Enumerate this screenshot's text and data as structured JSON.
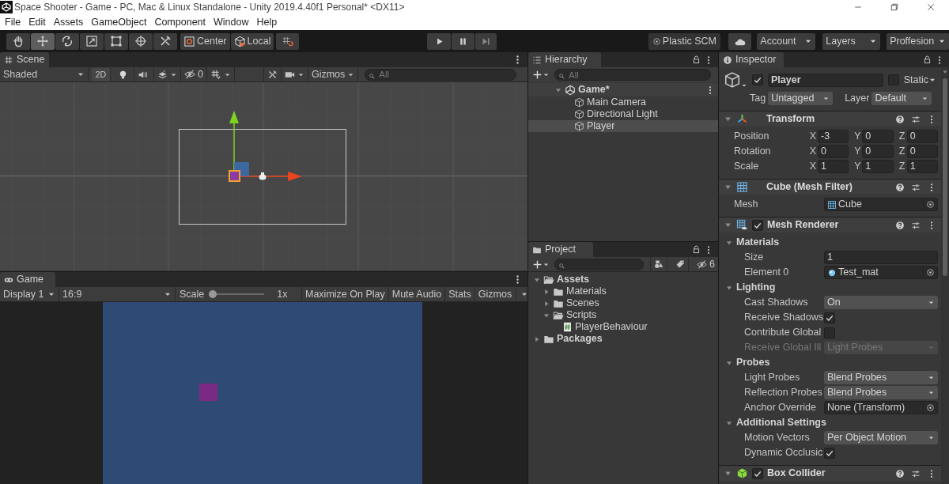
{
  "window": {
    "title": "Space Shooter - Game - PC, Mac & Linux Standalone - Unity 2019.4.40f1 Personal* <DX11>"
  },
  "menu": [
    "File",
    "Edit",
    "Assets",
    "GameObject",
    "Component",
    "Window",
    "Help"
  ],
  "toolbar": {
    "tools": [
      {
        "selected": false
      },
      {
        "selected": true
      },
      {
        "selected": false
      },
      {
        "selected": false
      },
      {
        "selected": false
      },
      {
        "selected": false
      },
      {
        "selected": false
      }
    ],
    "pivot": "Center",
    "space": "Local",
    "plastic": "Plastic SCM",
    "account": "Account",
    "layers": "Layers",
    "layout": "Proffesion"
  },
  "scene": {
    "tab": "Scene",
    "shading": "Shaded",
    "mode_2d": "2D",
    "hidden_count": "0",
    "gizmos": "Gizmos",
    "search_placeholder": "All"
  },
  "game": {
    "tab": "Game",
    "display": "Display 1",
    "aspect": "16:9",
    "scale_label": "Scale",
    "level": 0,
    "scale_value": "1x",
    "buttons": [
      "Maximize On Play",
      "Mute Audio",
      "Stats"
    ],
    "gizmos": "Gizmos"
  },
  "hierarchy": {
    "tab": "Hierarchy",
    "search_placeholder": "All",
    "scene": {
      "name": "Game*",
      "expanded": true,
      "children": [
        {
          "name": "Main Camera",
          "selected": false
        },
        {
          "name": "Directional Light",
          "selected": false
        },
        {
          "name": "Player",
          "selected": true
        }
      ]
    }
  },
  "project": {
    "tab": "Project",
    "hidden_count": "6",
    "tree": [
      {
        "name": "Assets",
        "kind": "folder",
        "expanded": true,
        "children": [
          {
            "name": "Materials",
            "kind": "folder",
            "expanded": false
          },
          {
            "name": "Scenes",
            "kind": "folder",
            "expanded": false
          },
          {
            "name": "Scripts",
            "kind": "folder",
            "expanded": true,
            "children": [
              {
                "name": "PlayerBehaviour",
                "kind": "script"
              }
            ]
          }
        ]
      },
      {
        "name": "Packages",
        "kind": "folder",
        "expanded": false
      }
    ]
  },
  "inspector": {
    "tab": "Inspector",
    "object": {
      "active": true,
      "name": "Player",
      "static": false,
      "static_label": "Static",
      "tag_label": "Tag",
      "tag": "Untagged",
      "layer_label": "Layer",
      "layer": "Default"
    },
    "components": [
      {
        "kind": "transform",
        "title": "Transform",
        "expanded": true,
        "sections": [
          {
            "rows": [
              {
                "kind": "vector3",
                "label": "Position",
                "fields": [
                  {
                    "axis": "X",
                    "value": "-3"
                  },
                  {
                    "axis": "Y",
                    "value": "0"
                  },
                  {
                    "axis": "Z",
                    "value": "0"
                  }
                ]
              },
              {
                "kind": "vector3",
                "label": "Rotation",
                "fields": [
                  {
                    "axis": "X",
                    "value": "0"
                  },
                  {
                    "axis": "Y",
                    "value": "0"
                  },
                  {
                    "axis": "Z",
                    "value": "0"
                  }
                ]
              },
              {
                "kind": "vector3",
                "label": "Scale",
                "fields": [
                  {
                    "axis": "X",
                    "value": "1"
                  },
                  {
                    "axis": "Y",
                    "value": "1"
                  },
                  {
                    "axis": "Z",
                    "value": "1"
                  }
                ]
              }
            ]
          }
        ]
      },
      {
        "kind": "mesh_filter",
        "title": "Cube (Mesh Filter)",
        "expanded": true,
        "sections": [
          {
            "rows": [
              {
                "kind": "mesh",
                "label": "Mesh",
                "value": "Cube"
              }
            ]
          }
        ]
      },
      {
        "kind": "mesh_renderer",
        "title": "Mesh Renderer",
        "enabled": true,
        "expanded": true,
        "sections": [
          {
            "title": "Materials",
            "expanded": true,
            "rows": [
              {
                "kind": "text",
                "label": "Size",
                "value": "1"
              },
              {
                "kind": "material",
                "label": "Element 0",
                "value": "Test_mat"
              }
            ]
          },
          {
            "title": "Lighting",
            "expanded": true,
            "rows": [
              {
                "kind": "dropdown",
                "label": "Cast Shadows",
                "value": "On",
                "disabled": false
              },
              {
                "kind": "checkbox",
                "label": "Receive Shadows",
                "checked": true
              },
              {
                "kind": "checkbox",
                "label": "Contribute Global",
                "checked": false
              },
              {
                "kind": "dropdown",
                "label": "Receive Global Ill",
                "value": "Light Probes",
                "disabled": true
              }
            ]
          },
          {
            "title": "Probes",
            "expanded": true,
            "rows": [
              {
                "kind": "dropdown",
                "label": "Light Probes",
                "value": "Blend Probes",
                "disabled": false
              },
              {
                "kind": "dropdown",
                "label": "Reflection Probes",
                "value": "Blend Probes",
                "disabled": false
              },
              {
                "kind": "object",
                "label": "Anchor Override",
                "value": "None (Transform)"
              }
            ]
          },
          {
            "title": "Additional Settings",
            "expanded": true,
            "rows": [
              {
                "kind": "dropdown",
                "label": "Motion Vectors",
                "value": "Per Object Motion",
                "disabled": false
              },
              {
                "kind": "checkbox",
                "label": "Dynamic Occlusic",
                "checked": true
              }
            ]
          }
        ]
      },
      {
        "kind": "box_collider",
        "title": "Box Collider",
        "enabled": true,
        "expanded": true
      }
    ]
  }
}
